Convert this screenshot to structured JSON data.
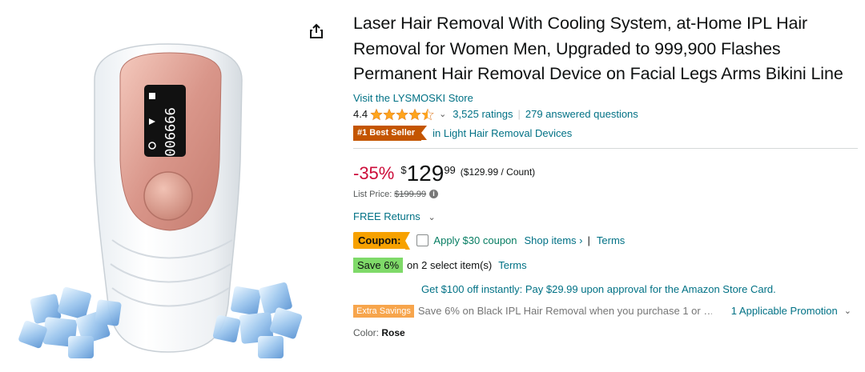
{
  "product": {
    "title": "Laser Hair Removal With Cooling System, at-Home IPL Hair Removal for Women Men, Upgraded to 999,900 Flashes Permanent Hair Removal Device on Facial Legs Arms Bikini Line",
    "store_link": "Visit the LYSMOSKI Store",
    "rating_value": "4.4",
    "rating_stars": 4.4,
    "ratings_count": "3,525 ratings",
    "answered_questions": "279 answered questions",
    "best_seller_badge": "#1 Best Seller",
    "best_seller_category": "in Light Hair Removal Devices",
    "device_display": "999900"
  },
  "price": {
    "discount": "-35%",
    "currency": "$",
    "whole": "129",
    "fraction": "99",
    "per_unit": "($129.99 / Count)",
    "list_price_label": "List Price:",
    "list_price": "$199.99",
    "info_icon": "i"
  },
  "returns": {
    "label": "FREE Returns",
    "chevron": "⌄"
  },
  "coupon": {
    "badge": "Coupon:",
    "apply_text": "Apply $30 coupon",
    "shop_items": "Shop items ›",
    "separator": "|",
    "terms": "Terms"
  },
  "save": {
    "badge": "Save 6%",
    "text": "on 2 select item(s)",
    "terms": "Terms"
  },
  "store_card": {
    "text": "Get $100 off instantly: Pay $29.99 upon approval for the Amazon Store Card."
  },
  "extra_savings": {
    "badge": "Extra Savings",
    "text": "Save 6% on Black IPL Hair Removal when you purchase 1 or …",
    "promotion": "1 Applicable Promotion",
    "chevron": "⌄"
  },
  "color": {
    "label": "Color:",
    "value": "Rose"
  },
  "icons": {
    "share": "share-icon",
    "star": "star-icon"
  },
  "colors": {
    "link": "#007185",
    "discount": "#cc0c39",
    "best_seller": "#c45500",
    "coupon": "#f7a100",
    "save": "#7fda69",
    "star": "#ffa41c"
  }
}
